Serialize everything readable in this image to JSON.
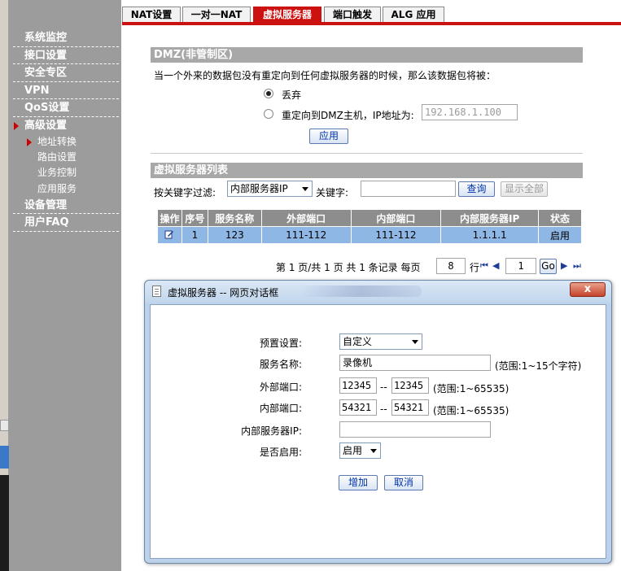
{
  "tabs": [
    "NAT设置",
    "一对一NAT",
    "虚拟服务器",
    "端口触发",
    "ALG 应用"
  ],
  "active_tab": 2,
  "sidebar": {
    "items": [
      {
        "label": "系统监控"
      },
      {
        "label": "接口设置"
      },
      {
        "label": "安全专区"
      },
      {
        "label": "VPN"
      },
      {
        "label": "QoS设置"
      },
      {
        "label": "高级设置"
      }
    ],
    "subitems": [
      {
        "label": "地址转换"
      },
      {
        "label": "路由设置"
      },
      {
        "label": "业务控制"
      },
      {
        "label": "应用服务"
      }
    ],
    "items_after": [
      {
        "label": "设备管理"
      },
      {
        "label": "用户FAQ"
      }
    ]
  },
  "dmz": {
    "title": "DMZ(非管制区)",
    "desc": "当一个外来的数据包没有重定向到任何虚拟服务器的时候，那么该数据包将被：",
    "opt_discard": "丢弃",
    "opt_redirect": "重定向到DMZ主机，IP地址为:",
    "ip_placeholder": "192.168.1.100",
    "apply": "应用"
  },
  "vslist": {
    "title": "虚拟服务器列表",
    "filter_label": "按关键字过滤:",
    "filter_value": "内部服务器IP",
    "keyword_label": "关键字:",
    "keyword_value": "",
    "query": "查询",
    "show_all": "显示全部",
    "columns": [
      "操作",
      "序号",
      "服务名称",
      "外部端口",
      "内部端口",
      "内部服务器IP",
      "状态"
    ],
    "rows": [
      {
        "idx": "1",
        "name": "123",
        "ext": "111-112",
        "int": "111-112",
        "ip": "1.1.1.1",
        "status": "启用"
      }
    ]
  },
  "pager": {
    "text1": "第 1 页/共 1 页 共 1 条记录 每页",
    "per_page": "8",
    "row_label": "行",
    "page_value": "1",
    "go": "Go"
  },
  "dialog": {
    "title": "虚拟服务器 -- 网页对话框",
    "close": "x",
    "preset_label": "预置设置:",
    "preset_value": "自定义",
    "name_label": "服务名称:",
    "name_value": "录像机",
    "name_note": "(范围:1~15个字符)",
    "ext_label": "外部端口:",
    "ext_from": "12345",
    "ext_to": "12345",
    "ext_note": "(范围:1~65535)",
    "int_label": "内部端口:",
    "int_from": "54321",
    "int_to": "54321",
    "int_note": "(范围:1~65535)",
    "ip_label": "内部服务器IP:",
    "ip_value": "",
    "enable_label": "是否启用:",
    "enable_value": "启用",
    "dash": "--",
    "add": "增加",
    "cancel": "取消"
  },
  "colors": {
    "accent_red": "#cc1111",
    "sidebar_gray": "#9c9c9c",
    "table_row_blue": "#8eb7e6"
  }
}
